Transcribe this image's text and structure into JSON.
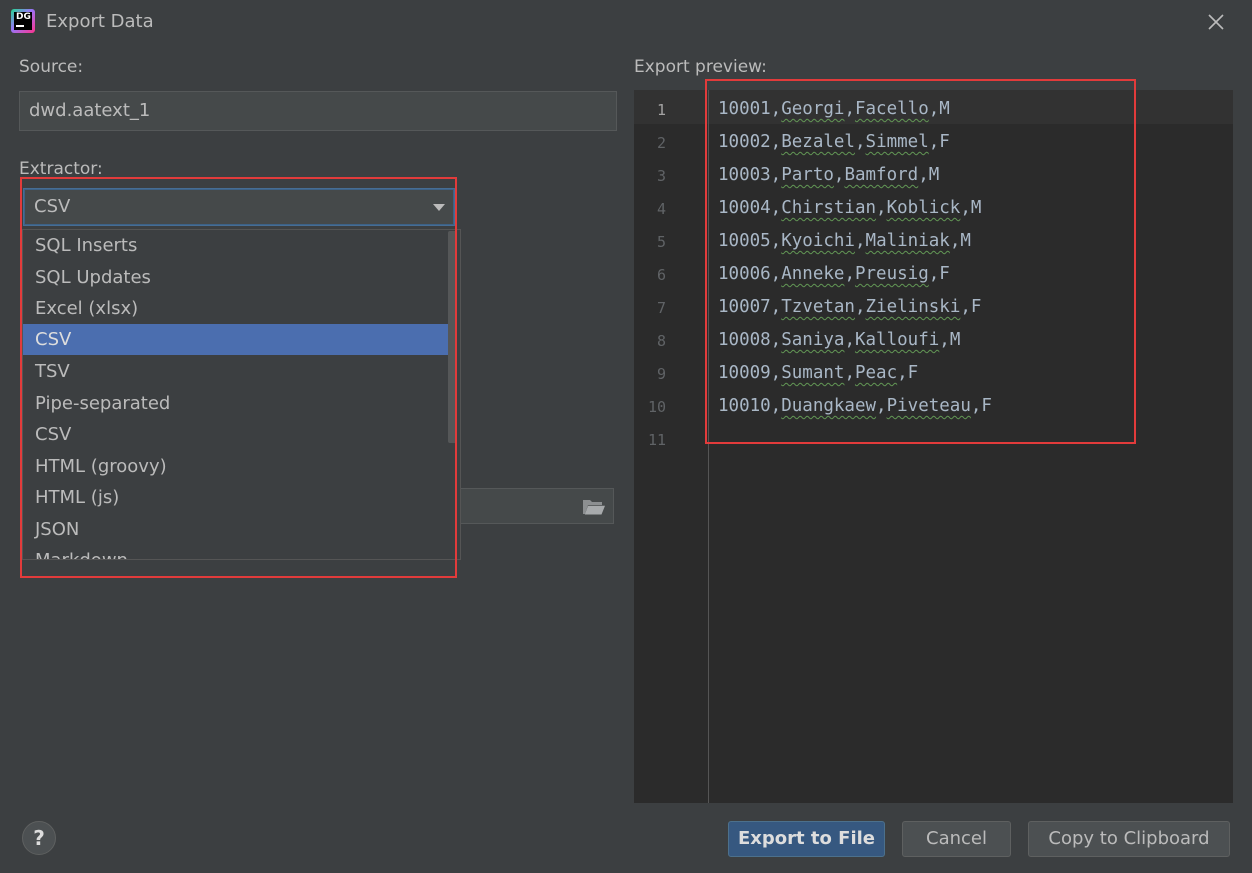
{
  "window": {
    "app_logo_text": "DG",
    "title": "Export Data"
  },
  "source": {
    "label": "Source:",
    "value": "dwd.aatext_1"
  },
  "extractor": {
    "label": "Extractor:",
    "selected": "CSV",
    "options": [
      "SQL Inserts",
      "SQL Updates",
      "Excel (xlsx)",
      "CSV",
      "TSV",
      "Pipe-separated",
      "CSV",
      "HTML (groovy)",
      "HTML (js)",
      "JSON",
      "Markdown"
    ],
    "selected_index": 3
  },
  "preview": {
    "label": "Export preview:",
    "lines": [
      {
        "num": "1",
        "parts": [
          "10001,",
          "Georgi",
          ",",
          "Facello",
          ",M"
        ]
      },
      {
        "num": "2",
        "parts": [
          "10002,",
          "Bezalel",
          ",",
          "Simmel",
          ",F"
        ]
      },
      {
        "num": "3",
        "parts": [
          "10003,",
          "Parto",
          ",",
          "Bamford",
          ",M"
        ]
      },
      {
        "num": "4",
        "parts": [
          "10004,",
          "Chirstian",
          ",",
          "Koblick",
          ",M"
        ]
      },
      {
        "num": "5",
        "parts": [
          "10005,",
          "Kyoichi",
          ",",
          "Maliniak",
          ",M"
        ]
      },
      {
        "num": "6",
        "parts": [
          "10006,",
          "Anneke",
          ",",
          "Preusig",
          ",F"
        ]
      },
      {
        "num": "7",
        "parts": [
          "10007,",
          "Tzvetan",
          ",",
          "Zielinski",
          ",F"
        ]
      },
      {
        "num": "8",
        "parts": [
          "10008,",
          "Saniya",
          ",",
          "Kalloufi",
          ",M"
        ]
      },
      {
        "num": "9",
        "parts": [
          "10009,",
          "Sumant",
          ",",
          "Peac",
          ",F"
        ]
      },
      {
        "num": "10",
        "parts": [
          "10010,",
          "Duangkaew",
          ",",
          "Piveteau",
          ",F"
        ]
      },
      {
        "num": "11",
        "parts": [
          "",
          "",
          "",
          "",
          ""
        ]
      }
    ]
  },
  "buttons": {
    "help": "?",
    "export_to_file": "Export to File",
    "cancel": "Cancel",
    "copy_to_clipboard": "Copy to Clipboard"
  },
  "colors": {
    "background": "#3c3f41",
    "editor_background": "#2b2b2b",
    "selection": "#4b6eaf",
    "primary_button": "#365880",
    "annotation_red": "#e23b3b"
  }
}
